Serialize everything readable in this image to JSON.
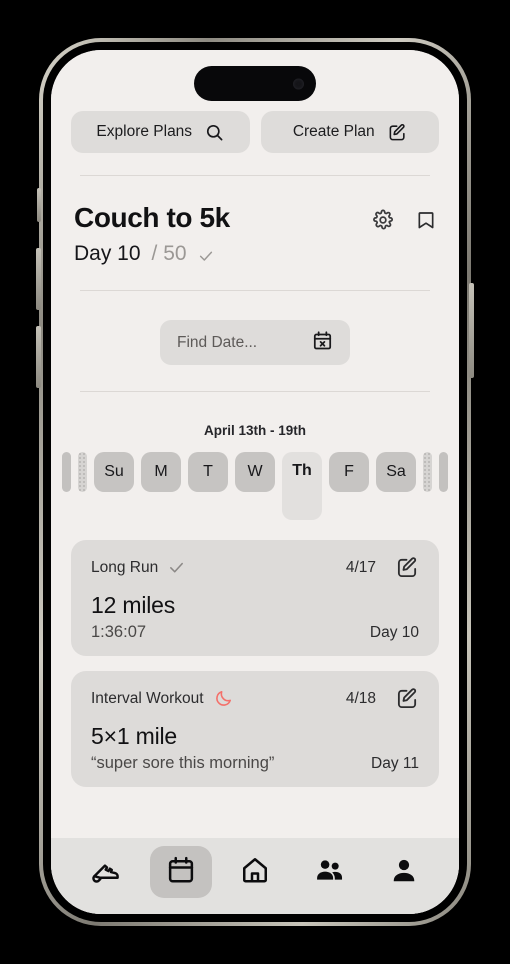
{
  "device": {
    "notch": "dynamic-island",
    "frame_color": "#8e8b82",
    "screen_bg": "#f2efed"
  },
  "toolbar": {
    "explore_label": "Explore Plans",
    "explore_icon": "search-icon",
    "create_label": "Create Plan",
    "create_icon": "edit-square-icon"
  },
  "plan": {
    "title": "Couch to 5k",
    "settings_icon": "gear-icon",
    "bookmark_icon": "bookmark-icon",
    "progress_current": "Day 10",
    "progress_total": "/ 50",
    "progress_check_icon": "check-icon"
  },
  "find_date": {
    "placeholder": "Find Date...",
    "icon": "calendar-clear-icon"
  },
  "week": {
    "range_label": "April 13th - 19th",
    "days": [
      {
        "label": "Su",
        "selected": false
      },
      {
        "label": "M",
        "selected": false
      },
      {
        "label": "T",
        "selected": false
      },
      {
        "label": "W",
        "selected": false
      },
      {
        "label": "Th",
        "selected": true
      },
      {
        "label": "F",
        "selected": false
      },
      {
        "label": "Sa",
        "selected": false
      }
    ]
  },
  "workouts": [
    {
      "type": "Long Run",
      "status_icon": "check-icon",
      "status_color": "#8b8886",
      "date": "4/17",
      "edit_icon": "edit-square-icon",
      "main": "12 miles",
      "sub": "1:36:07",
      "day": "Day 10"
    },
    {
      "type": "Interval Workout",
      "status_icon": "moon-icon",
      "status_color": "#f4706a",
      "date": "4/18",
      "edit_icon": "edit-square-icon",
      "main": "5×1 mile",
      "sub": "“super sore this morning”",
      "day": "Day 11"
    }
  ],
  "bottom_nav": [
    {
      "name": "shoe",
      "icon": "running-shoe-icon",
      "active": false
    },
    {
      "name": "calendar",
      "icon": "calendar-icon",
      "active": true
    },
    {
      "name": "home",
      "icon": "home-icon",
      "active": false
    },
    {
      "name": "friends",
      "icon": "people-icon",
      "active": false
    },
    {
      "name": "profile",
      "icon": "person-icon",
      "active": false
    }
  ]
}
